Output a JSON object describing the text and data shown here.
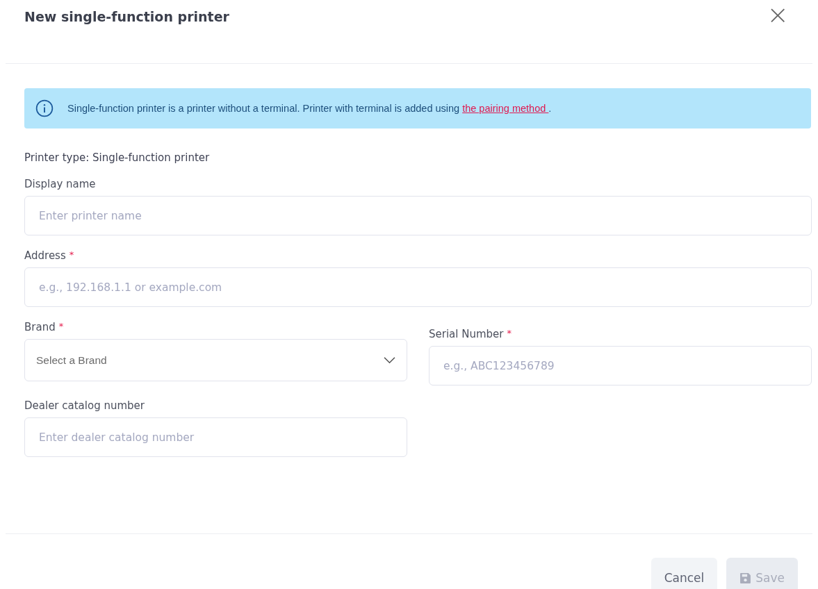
{
  "dialog": {
    "title": "New single-function printer",
    "close": "×"
  },
  "notice": {
    "text": "Single-function printer is a printer without a terminal. Printer with terminal is added using ",
    "link": "the pairing method ",
    "suffix": "."
  },
  "printer_type": "Printer type: Single-function printer",
  "rows": [
    [
      {
        "label": "Display name",
        "kind": "input",
        "placeholder": "Enter printer name"
      }
    ],
    [
      {
        "label": "Address",
        "required_mark": "*",
        "kind": "input",
        "placeholder": "e.g., 192.168.1.1 or example.com"
      }
    ],
    [
      {
        "label": "Brand",
        "required_mark": "*",
        "kind": "select",
        "placeholder": "Select a Brand"
      },
      {
        "label": "Serial Number",
        "required_mark": "*",
        "kind": "input",
        "placeholder": "e.g., ABC123456789"
      }
    ],
    [
      {
        "label": "Dealer catalog number",
        "kind": "input",
        "placeholder": "Enter dealer catalog number"
      }
    ]
  ],
  "buttons": [
    {
      "label": "Cancel",
      "kind": "cancel",
      "disabled": false
    },
    {
      "label": "Save",
      "kind": "save",
      "disabled": true
    }
  ]
}
